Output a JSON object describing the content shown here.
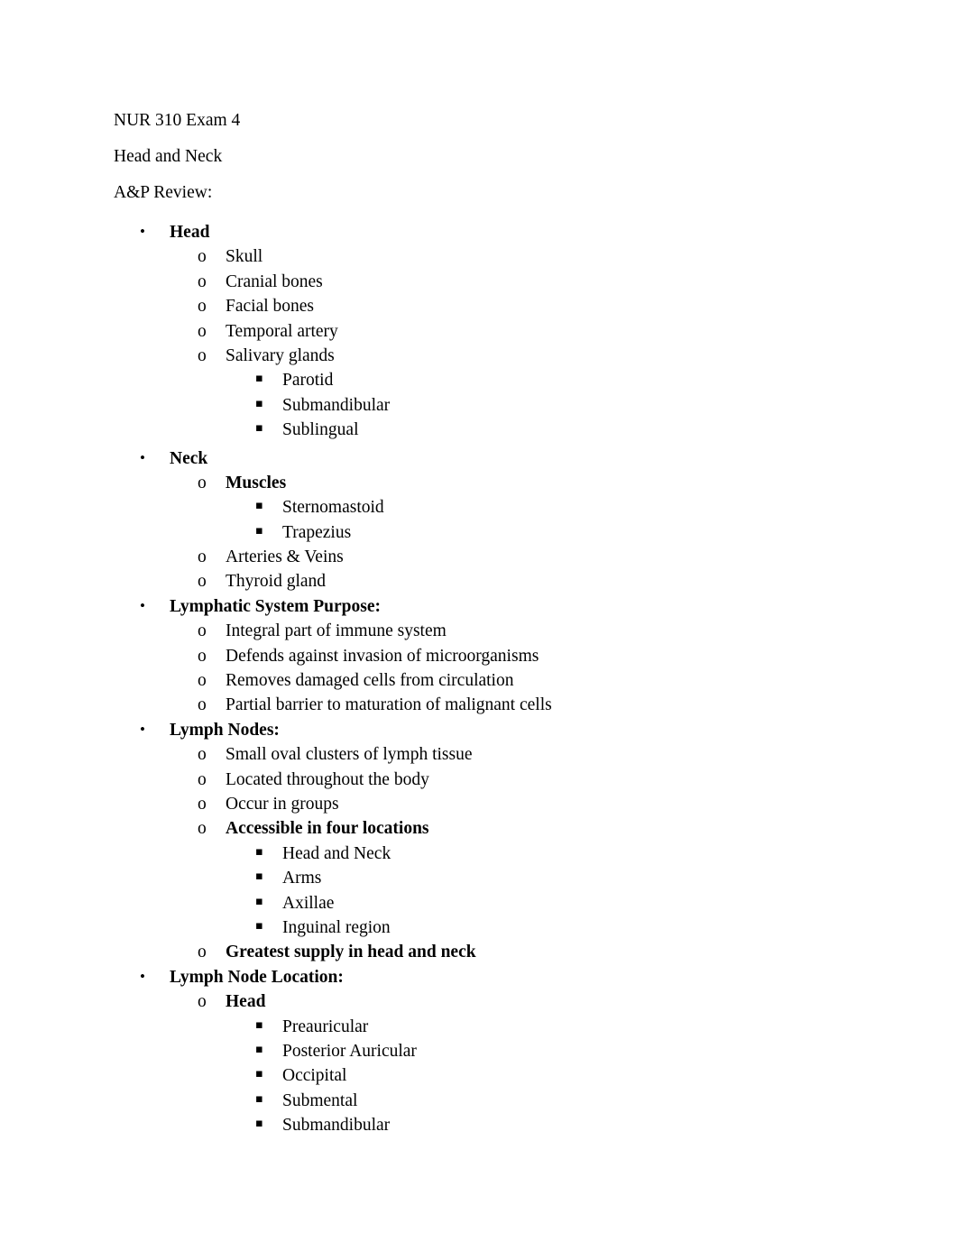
{
  "document": {
    "title": "NUR 310 Exam 4",
    "subtitle": "Head and Neck",
    "section_heading": "A&P Review:",
    "markers": {
      "level1": "•",
      "level2": "o",
      "level3": "▪"
    },
    "background_color": "#ffffff",
    "text_color": "#000000",
    "outline": [
      {
        "level": 1,
        "text": "Head",
        "bold": true,
        "extra_space_before": false
      },
      {
        "level": 2,
        "text": "Skull",
        "bold": false,
        "extra_space_before": false
      },
      {
        "level": 2,
        "text": "Cranial bones",
        "bold": false,
        "extra_space_before": false
      },
      {
        "level": 2,
        "text": "Facial bones",
        "bold": false,
        "extra_space_before": false
      },
      {
        "level": 2,
        "text": "Temporal artery",
        "bold": false,
        "extra_space_before": false
      },
      {
        "level": 2,
        "text": "Salivary glands",
        "bold": false,
        "extra_space_before": false
      },
      {
        "level": 3,
        "text": "Parotid",
        "bold": false,
        "extra_space_before": false
      },
      {
        "level": 3,
        "text": "Submandibular",
        "bold": false,
        "extra_space_before": false
      },
      {
        "level": 3,
        "text": "Sublingual",
        "bold": false,
        "extra_space_before": false
      },
      {
        "level": 1,
        "text": "Neck",
        "bold": true,
        "extra_space_before": true
      },
      {
        "level": 2,
        "text": "Muscles",
        "bold": true,
        "extra_space_before": false
      },
      {
        "level": 3,
        "text": "Sternomastoid",
        "bold": false,
        "extra_space_before": false
      },
      {
        "level": 3,
        "text": "Trapezius",
        "bold": false,
        "extra_space_before": false
      },
      {
        "level": 2,
        "text": "Arteries & Veins",
        "bold": false,
        "extra_space_before": false
      },
      {
        "level": 2,
        "text": "Thyroid gland",
        "bold": false,
        "extra_space_before": false
      },
      {
        "level": 1,
        "text": "Lymphatic System Purpose:",
        "bold": true,
        "extra_space_before": false
      },
      {
        "level": 2,
        "text": "Integral part of immune system",
        "bold": false,
        "extra_space_before": false
      },
      {
        "level": 2,
        "text": "Defends against invasion of microorganisms",
        "bold": false,
        "extra_space_before": false
      },
      {
        "level": 2,
        "text": "Removes damaged cells from circulation",
        "bold": false,
        "extra_space_before": false
      },
      {
        "level": 2,
        "text": "Partial barrier to maturation of malignant cells",
        "bold": false,
        "extra_space_before": false
      },
      {
        "level": 1,
        "text": "Lymph Nodes:",
        "bold": true,
        "extra_space_before": false
      },
      {
        "level": 2,
        "text": "Small oval clusters of lymph tissue",
        "bold": false,
        "extra_space_before": false
      },
      {
        "level": 2,
        "text": "Located throughout the body",
        "bold": false,
        "extra_space_before": false
      },
      {
        "level": 2,
        "text": "Occur in groups",
        "bold": false,
        "extra_space_before": false
      },
      {
        "level": 2,
        "text": "Accessible in four locations",
        "bold": true,
        "extra_space_before": false
      },
      {
        "level": 3,
        "text": "Head and Neck",
        "bold": false,
        "extra_space_before": false
      },
      {
        "level": 3,
        "text": "Arms",
        "bold": false,
        "extra_space_before": false
      },
      {
        "level": 3,
        "text": "Axillae",
        "bold": false,
        "extra_space_before": false
      },
      {
        "level": 3,
        "text": "Inguinal region",
        "bold": false,
        "extra_space_before": false
      },
      {
        "level": 2,
        "text": "Greatest supply in head and neck",
        "bold": true,
        "extra_space_before": false
      },
      {
        "level": 1,
        "text": "Lymph Node Location:",
        "bold": true,
        "extra_space_before": false
      },
      {
        "level": 2,
        "text": "Head",
        "bold": true,
        "extra_space_before": false
      },
      {
        "level": 3,
        "text": "Preauricular",
        "bold": false,
        "extra_space_before": false
      },
      {
        "level": 3,
        "text": "Posterior Auricular",
        "bold": false,
        "extra_space_before": false
      },
      {
        "level": 3,
        "text": "Occipital",
        "bold": false,
        "extra_space_before": false
      },
      {
        "level": 3,
        "text": "Submental",
        "bold": false,
        "extra_space_before": false
      },
      {
        "level": 3,
        "text": "Submandibular",
        "bold": false,
        "extra_space_before": false
      }
    ]
  }
}
